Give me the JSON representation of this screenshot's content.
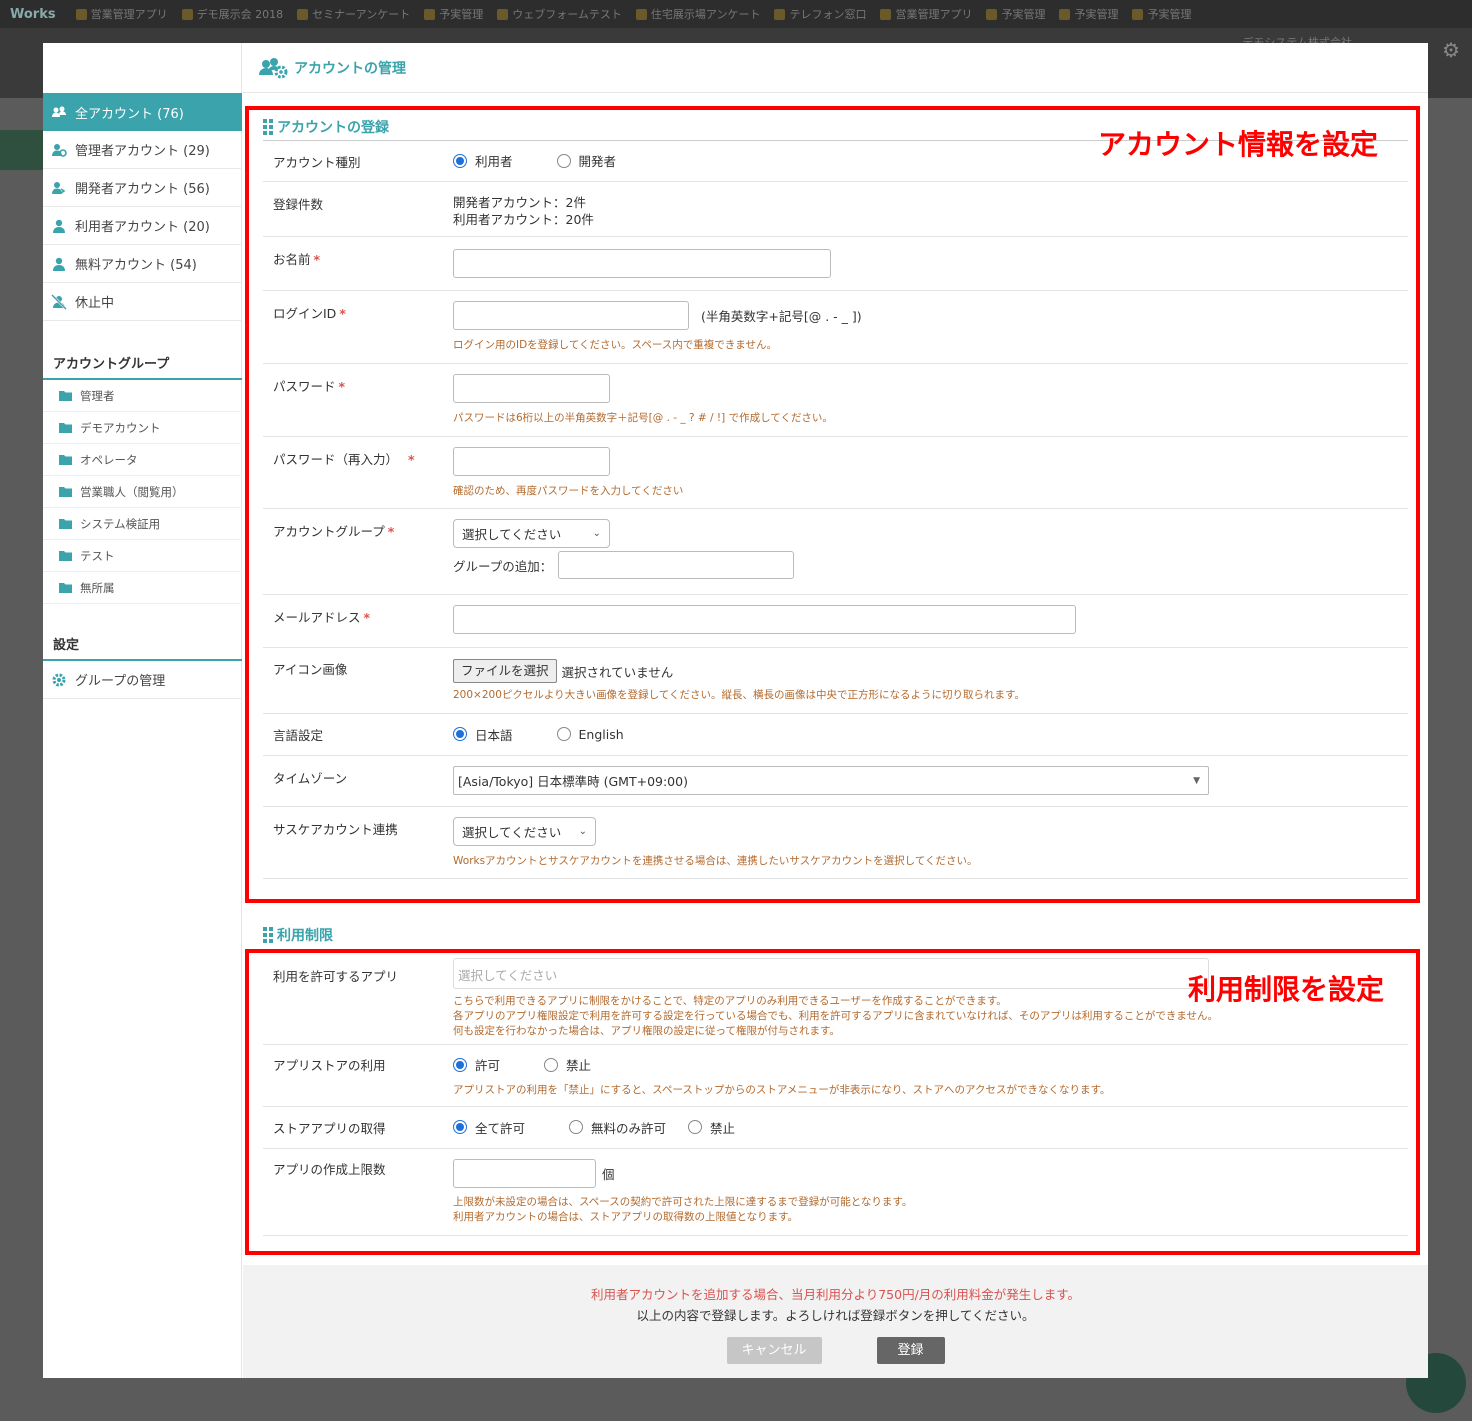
{
  "background": {
    "logo": "Works",
    "tabs": [
      "営業管理アプリ",
      "デモ展示会 2018",
      "セミナーアンケート",
      "予実管理",
      "ウェブフォームテスト",
      "住宅展示場アンケート",
      "テレフォン窓口",
      "営業管理アプリ",
      "予実管理",
      "予実管理",
      "予実管理"
    ],
    "company": "デモシステム株式会社"
  },
  "modal": {
    "title": "アカウントの管理",
    "sidebar": {
      "items": [
        {
          "label": "全アカウント (76)",
          "icon": "users-icon",
          "active": true
        },
        {
          "label": "管理者アカウント (29)",
          "icon": "admin-users-icon"
        },
        {
          "label": "開発者アカウント (56)",
          "icon": "developer-users-icon"
        },
        {
          "label": "利用者アカウント (20)",
          "icon": "user-icon"
        },
        {
          "label": "無料アカウント (54)",
          "icon": "user-icon"
        },
        {
          "label": "休止中",
          "icon": "user-slash-icon"
        }
      ],
      "group_heading": "アカウントグループ",
      "groups": [
        "管理者",
        "デモアカウント",
        "オペレータ",
        "営業職人（閲覧用）",
        "システム検証用",
        "テスト",
        "無所属"
      ],
      "settings_heading": "設定",
      "settings_items": [
        {
          "label": "グループの管理",
          "icon": "gear-icon"
        }
      ]
    },
    "register": {
      "title": "アカウントの登録",
      "account_type": {
        "label": "アカウント種別",
        "options": [
          "利用者",
          "開発者"
        ],
        "selected": "利用者"
      },
      "count": {
        "label": "登録件数",
        "lines": [
          "開発者アカウント：2件",
          "利用者アカウント：20件"
        ]
      },
      "name": {
        "label": "お名前"
      },
      "login_id": {
        "label": "ログインID",
        "note": "(半角英数字+記号[@ . - _ ])",
        "hint": "ログイン用のIDを登録してください。スペース内で重複できません。"
      },
      "password": {
        "label": "パスワード",
        "hint": "パスワードは6桁以上の半角英数字＋記号[@ . - _ ? # / !] で作成してください。"
      },
      "password_confirm": {
        "label": "パスワード（再入力）",
        "hint": "確認のため、再度パスワードを入力してください"
      },
      "group": {
        "label": "アカウントグループ",
        "select": "選択してください",
        "add_label": "グループの追加："
      },
      "email": {
        "label": "メールアドレス"
      },
      "icon_image": {
        "label": "アイコン画像",
        "button": "ファイルを選択",
        "status": "選択されていません",
        "hint": "200×200ピクセルより大きい画像を登録してください。縦長、横長の画像は中央で正方形になるように切り取られます。"
      },
      "language": {
        "label": "言語設定",
        "options": [
          "日本語",
          "English"
        ],
        "selected": "日本語"
      },
      "timezone": {
        "label": "タイムゾーン",
        "value": "[Asia/Tokyo] 日本標準時 (GMT+09:00)"
      },
      "saske": {
        "label": "サスケアカウント連携",
        "select": "選択してください",
        "hint": "Worksアカウントとサスケアカウントを連携させる場合は、連携したいサスケアカウントを選択してください。"
      }
    },
    "limits": {
      "title": "利用制限",
      "allowed_apps": {
        "label": "利用を許可するアプリ",
        "placeholder": "選択してください",
        "hints": [
          "こちらで利用できるアプリに制限をかけることで、特定のアプリのみ利用できるユーザーを作成することができます。",
          "各アプリのアプリ権限設定で利用を許可する設定を行っている場合でも、利用を許可するアプリに含まれていなければ、そのアプリは利用することができません。",
          "何も設定を行わなかった場合は、アプリ権限の設定に従って権限が付与されます。"
        ]
      },
      "app_store": {
        "label": "アプリストアの利用",
        "options": [
          "許可",
          "禁止"
        ],
        "selected": "許可",
        "hint": "アプリストアの利用を「禁止」にすると、スペーストップからのストアメニューが非表示になり、ストアへのアクセスができなくなります。"
      },
      "store_get": {
        "label": "ストアアプリの取得",
        "options": [
          "全て許可",
          "無料のみ許可",
          "禁止"
        ],
        "selected": "全て許可"
      },
      "app_limit": {
        "label": "アプリの作成上限数",
        "unit": "個",
        "hints": [
          "上限数が未設定の場合は、スペースの契約で許可された上限に達するまで登録が可能となります。",
          "利用者アカウントの場合は、ストアアプリの取得数の上限値となります。"
        ]
      }
    },
    "annotations": {
      "account_info": "アカウント情報を設定",
      "limits": "利用制限を設定"
    },
    "footer": {
      "fee_notice": "利用者アカウントを追加する場合、当月利用分より750円/月の利用料金が発生します。",
      "confirm": "以上の内容で登録します。よろしければ登録ボタンを押してください。",
      "cancel": "キャンセル",
      "submit": "登録"
    }
  },
  "colors": {
    "accent": "#3aa3ac",
    "hint": "#b36a2e",
    "required": "#d9534f",
    "annotation": "#ff0000"
  }
}
